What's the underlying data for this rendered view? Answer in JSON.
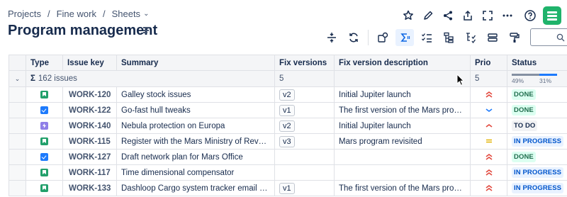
{
  "breadcrumb": {
    "items": [
      "Projects",
      "Fine work",
      "Sheets"
    ]
  },
  "page": {
    "title": "Program management"
  },
  "colors": {
    "accent": "#1d7afc",
    "done": "#216e4e",
    "brand": "#1fb36b",
    "priority_high": "#e2483d",
    "priority_low": "#1d7afc",
    "priority_medium": "#e2b203"
  },
  "top_actions": [
    "star-icon",
    "edit-icon",
    "share-icon",
    "export-icon",
    "fullscreen-icon",
    "more-icon",
    "help-icon",
    "app-logo"
  ],
  "toolbar": [
    "row-height-icon",
    "refresh-icon",
    "view-settings-icon",
    "sum-icon",
    "checklist-icon",
    "hierarchy-icon",
    "sort-hierarchy-icon",
    "group-icon",
    "format-painter-icon"
  ],
  "table": {
    "headers": [
      "Type",
      "Issue key",
      "Summary",
      "Fix versions",
      "Fix version description",
      "Prio",
      "Status"
    ],
    "summary": {
      "sigma": "Σ",
      "label": "162 issues",
      "fix_versions": "5",
      "prio": "5",
      "status_done_pct": "49%",
      "status_progress_pct": "31%",
      "done_fraction": 0.49,
      "progress_fraction": 0.31
    },
    "rows": [
      {
        "type": "story",
        "key": "WORK-120",
        "summary": "Galley stock issues",
        "fix_version": "v2",
        "description": "Initial Jupiter launch",
        "prio": "highest",
        "status": "DONE",
        "status_kind": "done"
      },
      {
        "type": "task",
        "key": "WORK-122",
        "summary": "Go-fast hull tweaks",
        "fix_version": "v1",
        "description": "The first version of the Mars program",
        "prio": "low",
        "status": "DONE",
        "status_kind": "done"
      },
      {
        "type": "epic",
        "key": "WORK-140",
        "summary": "Nebula protection on Europa",
        "fix_version": "v2",
        "description": "Initial Jupiter launch",
        "prio": "high",
        "status": "TO DO",
        "status_kind": "todo"
      },
      {
        "type": "story",
        "key": "WORK-115",
        "summary": "Register with the Mars Ministry of Revenue",
        "fix_version": "v3",
        "description": "Mars program revisited",
        "prio": "medium",
        "status": "IN PROGRESS",
        "status_kind": "prog"
      },
      {
        "type": "task",
        "key": "WORK-127",
        "summary": "Draft network plan for Mars Office",
        "fix_version": "",
        "description": "",
        "prio": "highest",
        "status": "DONE",
        "status_kind": "done"
      },
      {
        "type": "story",
        "key": "WORK-117",
        "summary": "Time dimensional compensator",
        "fix_version": "",
        "description": "",
        "prio": "highest",
        "status": "IN PROGRESS",
        "status_kind": "prog"
      },
      {
        "type": "story",
        "key": "WORK-133",
        "summary": "Dashloop Cargo system tracker email setup",
        "fix_version": "v1",
        "description": "The first version of the Mars program",
        "prio": "highest",
        "status": "IN PROGRESS",
        "status_kind": "prog"
      }
    ]
  }
}
